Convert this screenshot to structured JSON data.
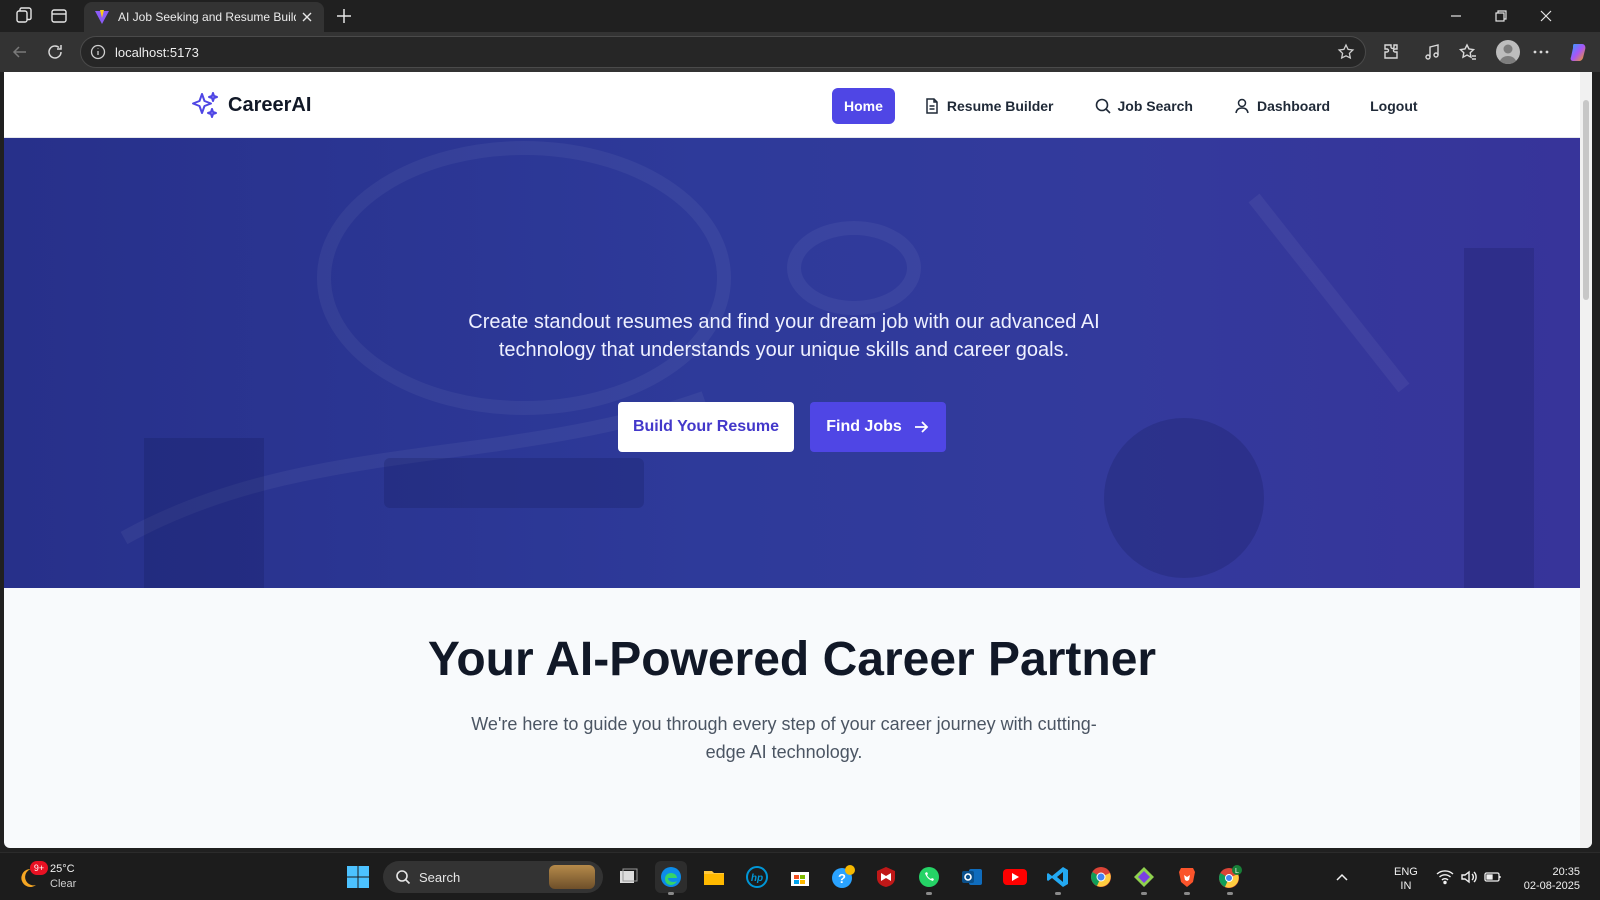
{
  "browser": {
    "tab_title": "AI Job Seeking and Resume Build",
    "url": "localhost:5173"
  },
  "site": {
    "logo_text": "CareerAI",
    "nav": [
      {
        "label": "Home",
        "icon": "none",
        "active": true
      },
      {
        "label": "Resume Builder",
        "icon": "document-icon",
        "active": false
      },
      {
        "label": "Job Search",
        "icon": "search-icon",
        "active": false
      },
      {
        "label": "Dashboard",
        "icon": "user-icon",
        "active": false
      },
      {
        "label": "Logout",
        "icon": "none",
        "active": false
      }
    ],
    "hero": {
      "subtitle": "Create standout resumes and find your dream job with our advanced AI technology that understands your unique skills and career goals.",
      "btn_resume": "Build Your Resume",
      "btn_jobs": "Find Jobs"
    },
    "section": {
      "title": "Your AI-Powered Career Partner",
      "subtitle": "We're here to guide you through every step of your career journey with cutting-edge AI technology."
    },
    "colors": {
      "accent": "#4f46e5",
      "hero_bg": "#2e3a9a",
      "page_bg": "#f8fafc"
    }
  },
  "taskbar": {
    "weather_badge": "9+",
    "weather_temp": "25°C",
    "weather_cond": "Clear",
    "search_label": "Search",
    "lang_1": "ENG",
    "lang_2": "IN",
    "time": "20:35",
    "date": "02-08-2025"
  }
}
